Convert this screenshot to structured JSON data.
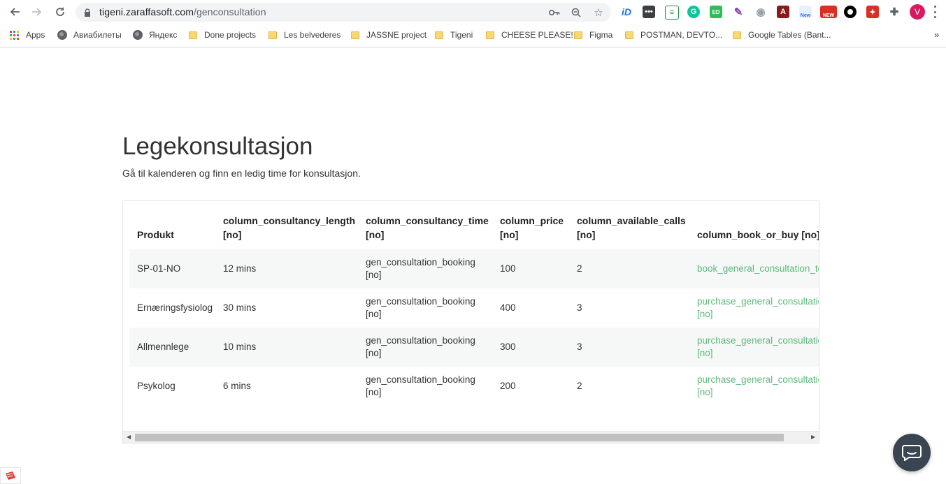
{
  "browser": {
    "url_domain": "tigeni.zaraffasoft.com",
    "url_path": "/genconsultation",
    "avatar_letter": "V",
    "extensions": [
      {
        "name": "id-extension-icon",
        "label": "iD",
        "color": "#1a73e8"
      },
      {
        "name": "dots-extension-icon",
        "label": "•••",
        "color": "#3c4043"
      },
      {
        "name": "sheets-extension-icon",
        "label": "≡",
        "color": "#1e8e3e"
      },
      {
        "name": "grammarly-extension-icon",
        "label": "G",
        "color": "#15c39a"
      },
      {
        "name": "ed-extension-icon",
        "label": "ED",
        "color": "#2ebd59"
      },
      {
        "name": "feather-extension-icon",
        "label": "✎",
        "color": "#8e44ad"
      },
      {
        "name": "camera-extension-icon",
        "label": "◉",
        "color": "#9aa0a6"
      },
      {
        "name": "pdf-extension-icon",
        "label": "A",
        "color": "#8b1a1a"
      },
      {
        "name": "new-extension-icon",
        "label": "New",
        "color": "#1a73e8"
      },
      {
        "name": "new-badge-extension-icon",
        "label": "NEW",
        "color": "#d93025"
      },
      {
        "name": "circle-extension-icon",
        "label": "",
        "color": "#000000"
      },
      {
        "name": "red-extension-icon",
        "label": "✦",
        "color": "#d93025"
      },
      {
        "name": "puzzle-extension-icon",
        "label": "✚",
        "color": "#5f6368"
      }
    ]
  },
  "bookmarks": {
    "items": [
      {
        "label": "Apps",
        "type": "apps"
      },
      {
        "label": "Авиабилеты",
        "type": "globe"
      },
      {
        "label": "Яндекс",
        "type": "globe"
      },
      {
        "label": "Done projects",
        "type": "folder"
      },
      {
        "label": "Les belvederes",
        "type": "folder"
      },
      {
        "label": "JASSNE project",
        "type": "folder"
      },
      {
        "label": "Tigeni",
        "type": "folder"
      },
      {
        "label": "CHEESE PLEASE!",
        "type": "folder"
      },
      {
        "label": "Figma",
        "type": "folder"
      },
      {
        "label": "POSTMAN, DEVTO...",
        "type": "folder"
      },
      {
        "label": "Google Tables (Bant...",
        "type": "folder"
      }
    ],
    "overflow": "»"
  },
  "page": {
    "title": "Legekonsultasjon",
    "subtitle": "Gå til kalenderen og finn en ledig time for konsultasjon."
  },
  "table": {
    "headers": [
      {
        "line1": "Produkt",
        "line2": ""
      },
      {
        "line1": "column_consultancy_length",
        "line2": "[no]"
      },
      {
        "line1": "column_consultancy_time",
        "line2": "[no]"
      },
      {
        "line1": "column_price",
        "line2": "[no]"
      },
      {
        "line1": "column_available_calls",
        "line2": "[no]"
      },
      {
        "line1": "column_book_or_buy [no]",
        "line2": ""
      }
    ],
    "rows": [
      {
        "product": "SP-01-NO",
        "length": "12 mins",
        "time_line1": "gen_consultation_booking",
        "time_line2": "[no]",
        "price": "100",
        "calls": "2",
        "action_line1": "book_general_consultation_text",
        "action_line2": ""
      },
      {
        "product": "Ernæringsfysiolog",
        "length": "30 mins",
        "time_line1": "gen_consultation_booking",
        "time_line2": "[no]",
        "price": "400",
        "calls": "3",
        "action_line1": "purchase_general_consultation_",
        "action_line2": "[no]"
      },
      {
        "product": "Allmennlege",
        "length": "10 mins",
        "time_line1": "gen_consultation_booking",
        "time_line2": "[no]",
        "price": "300",
        "calls": "3",
        "action_line1": "purchase_general_consultation_",
        "action_line2": "[no]"
      },
      {
        "product": "Psykolog",
        "length": "6 mins",
        "time_line1": "gen_consultation_booking",
        "time_line2": "[no]",
        "price": "200",
        "calls": "2",
        "action_line1": "purchase_general_consultation_",
        "action_line2": "[no]"
      }
    ]
  },
  "colors": {
    "link_green": "#5cb97c",
    "chat_button": "#3b4451"
  }
}
